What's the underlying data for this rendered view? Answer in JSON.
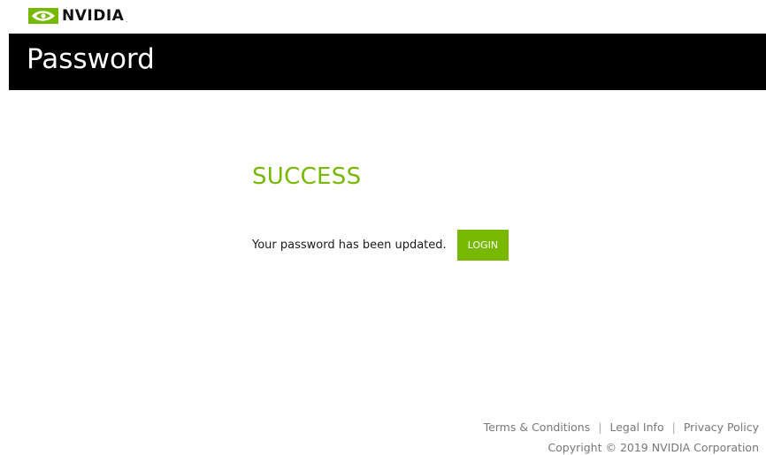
{
  "brand": {
    "wordmark": "NVIDIA",
    "logo_icon": "nvidia-eye-icon",
    "accent_color": "#76b900"
  },
  "header": {
    "title": "Password"
  },
  "main": {
    "status_title": "SUCCESS",
    "message": "Your password has been updated.",
    "login_label": "LOGIN"
  },
  "footer": {
    "links": [
      {
        "label": "Terms & Conditions"
      },
      {
        "label": "Legal Info"
      },
      {
        "label": "Privacy Policy"
      }
    ],
    "separator": "|",
    "copyright": "Copyright © 2019 NVIDIA Corporation"
  }
}
